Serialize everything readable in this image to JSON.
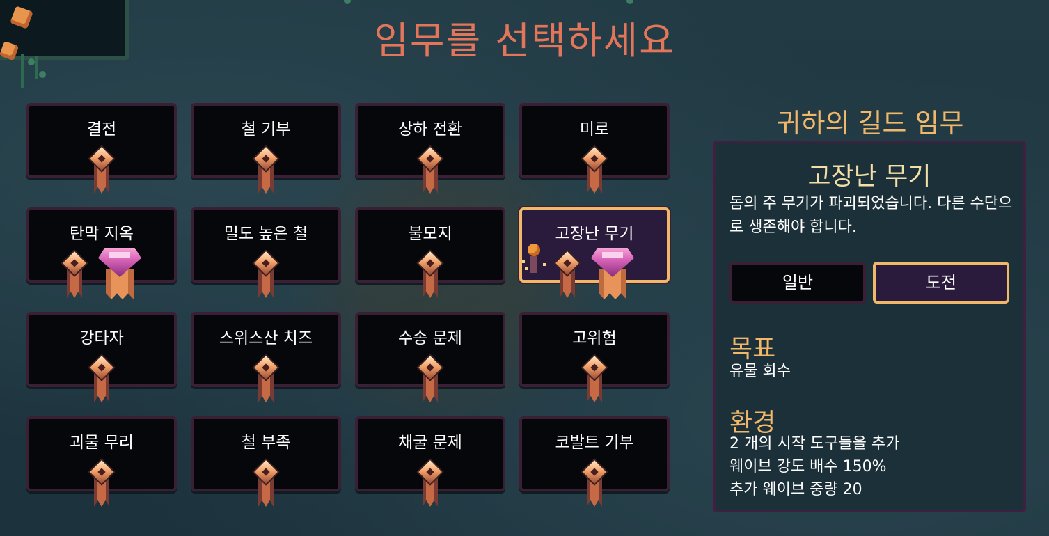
{
  "title": "임무를 선택하세요",
  "missions": [
    {
      "label": "결전",
      "gem": false
    },
    {
      "label": "철 기부",
      "gem": false
    },
    {
      "label": "상하 전환",
      "gem": false
    },
    {
      "label": "미로",
      "gem": false
    },
    {
      "label": "탄막 지옥",
      "gem": true
    },
    {
      "label": "밀도 높은 철",
      "gem": false
    },
    {
      "label": "불모지",
      "gem": false
    },
    {
      "label": "고장난 무기",
      "gem": true,
      "selected": true
    },
    {
      "label": "강타자",
      "gem": false
    },
    {
      "label": "스위스산 치즈",
      "gem": false
    },
    {
      "label": "수송 문제",
      "gem": false
    },
    {
      "label": "고위험",
      "gem": false
    },
    {
      "label": "괴물 무리",
      "gem": false
    },
    {
      "label": "철 부족",
      "gem": false
    },
    {
      "label": "채굴 문제",
      "gem": false
    },
    {
      "label": "코발트 기부",
      "gem": false
    }
  ],
  "panel": {
    "heading": "귀하의 길드 임무",
    "mission_name": "고장난 무기",
    "description": "돔의 주 무기가 파괴되었습니다. 다른 수단으로 생존해야 합니다.",
    "difficulty_normal": "일반",
    "difficulty_challenge": "도전",
    "difficulty_selected": "도전",
    "goal_heading": "목표",
    "goal_text": "유물 회수",
    "environment_heading": "환경",
    "environment_lines": [
      "2 개의 시작 도구들을 추가",
      "웨이브 강도 배수 150%",
      "추가 웨이브 중량 20"
    ]
  },
  "colors": {
    "title": "#e3765a",
    "accent": "#f2b86a",
    "card_bg": "#05070b",
    "card_border": "#3a1f35",
    "selected_bg": "#2a1b3d"
  },
  "icons": [
    "mission-badge-icon",
    "gem-badge-icon",
    "keeper-character-icon"
  ]
}
